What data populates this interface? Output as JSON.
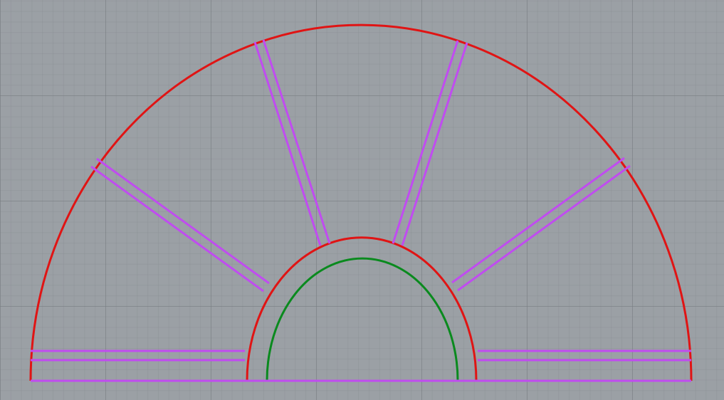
{
  "viewport": {
    "background": "#9ba0a5",
    "grid_minor_color": "#878c91",
    "grid_major_color": "#787d82"
  },
  "colors": {
    "outer_arc": "#e01414",
    "inner_arc": "#e01414",
    "core_arc": "#0a8a1e",
    "spokes": "#c04cf0",
    "base_line": "#c04cf0"
  },
  "drawing": {
    "spoke_count": 6,
    "spoke_style": "double-line",
    "shape": "half-wheel"
  }
}
